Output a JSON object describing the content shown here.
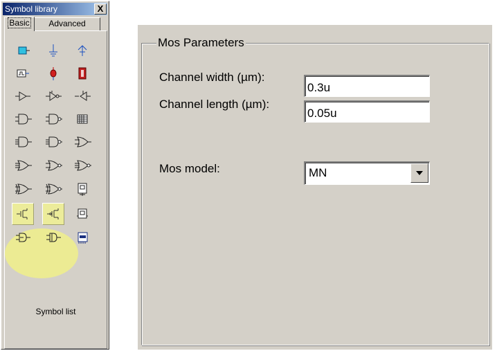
{
  "palette": {
    "title": "Symbol library",
    "close_label": "X",
    "tabs": {
      "basic": "Basic",
      "advanced": "Advanced"
    },
    "symbol_list_label": "Symbol list",
    "icons": [
      [
        "input-port-icon",
        "ground-icon",
        "power-supply-icon"
      ],
      [
        "clock-source-icon",
        "vdd-supply-icon",
        "resistor-icon"
      ],
      [
        "buffer-icon",
        "inverter-icon",
        "inverter-left-icon"
      ],
      [
        "and-gate-icon",
        "nand-gate-icon",
        "memory-grid-icon"
      ],
      [
        "and3-gate-icon",
        "nand3-gate-icon",
        "or-gate-icon"
      ],
      [
        "or3-gate-icon",
        "nor-gate-icon",
        "nor3-gate-icon"
      ],
      [
        "xor-gate-icon",
        "xnor-gate-icon",
        "flip-flop-icon"
      ],
      [
        "nmos-icon",
        "pmos-icon",
        "latch-icon"
      ],
      [
        "complex-gate-icon",
        "complex-gate2-icon",
        "chip-icon"
      ]
    ]
  },
  "mos_parameters": {
    "title": "Mos Parameters",
    "channel_width_label": "Channel width (µm):",
    "channel_width_value": "0.3u",
    "channel_length_label": "Channel length (µm):",
    "channel_length_value": "0.05u",
    "mos_model_label": "Mos model:",
    "mos_model_value": "MN"
  },
  "colors": {
    "window_bg": "#d4d0c8",
    "title_gradient_start": "#0a246a",
    "title_gradient_end": "#a6caf0",
    "highlight": "#f0f08a"
  }
}
